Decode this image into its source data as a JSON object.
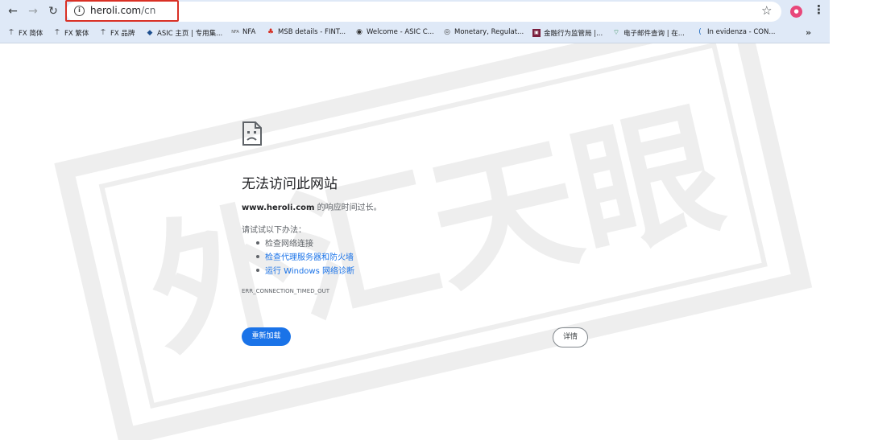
{
  "toolbar": {
    "back_icon": "back-arrow-icon",
    "forward_icon": "forward-arrow-icon",
    "reload_icon": "reload-icon",
    "url_host": "heroli.com",
    "url_path": "/cn",
    "star_icon": "bookmark-star-icon",
    "menu_icon": "kebab-menu-icon"
  },
  "bookmarks": [
    {
      "label": "FX 简体",
      "icon": "fx-icon"
    },
    {
      "label": "FX 繁体",
      "icon": "fx-icon"
    },
    {
      "label": "FX 品牌",
      "icon": "fx-icon"
    },
    {
      "label": "ASIC 主页 | 专用集...",
      "icon": "asic-icon"
    },
    {
      "label": "NFA",
      "icon": "nfa-icon"
    },
    {
      "label": "MSB details - FINT...",
      "icon": "maple-leaf-icon"
    },
    {
      "label": "Welcome - ASIC C...",
      "icon": "globe-icon"
    },
    {
      "label": "Monetary, Regulat...",
      "icon": "seal-icon"
    },
    {
      "label": "金融行为监管局 |...",
      "icon": "fca-icon"
    },
    {
      "label": "电子邮件查询 | 在...",
      "icon": "wifi-icon"
    },
    {
      "label": "In evidenza - CON...",
      "icon": "bracket-icon"
    }
  ],
  "bookmarks_more": "»",
  "error": {
    "title": "无法访问此网站",
    "host": "www.heroli.com",
    "message": " 的响应时间过长。",
    "try_title": "请试试以下办法：",
    "suggestions": [
      "检查网络连接",
      "检查代理服务器和防火墙",
      "运行 Windows 网络诊断"
    ],
    "code": "ERR_CONNECTION_TIMED_OUT",
    "reload_label": "重新加载",
    "details_label": "详情"
  },
  "watermark": {
    "text": "外汇天眼"
  },
  "colors": {
    "toolbar_bg": "#dfe9f7",
    "link": "#1a73e8",
    "button_primary": "#1a73e8",
    "highlight": "#d93025"
  }
}
